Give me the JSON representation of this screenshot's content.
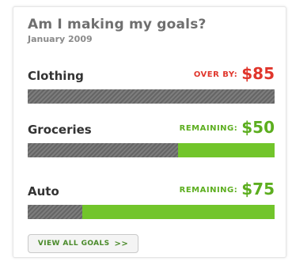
{
  "widget": {
    "title": "Am I making my goals?",
    "subtitle": "January 2009",
    "button_label": "VIEW ALL GOALS",
    "button_icon": "double-chevron-right-icon",
    "button_icon_glyph": ">>"
  },
  "colors": {
    "over": "#e0362c",
    "remaining": "#5cae1f"
  },
  "goals": [
    {
      "name": "Clothing",
      "status_label": "OVER BY:",
      "amount": "$85",
      "status": "over",
      "remaining_fraction": 0.0
    },
    {
      "name": "Groceries",
      "status_label": "REMAINING:",
      "amount": "$50",
      "status": "remaining",
      "remaining_fraction": 0.39
    },
    {
      "name": "Auto",
      "status_label": "REMAINING:",
      "amount": "$75",
      "status": "remaining",
      "remaining_fraction": 0.78
    }
  ]
}
